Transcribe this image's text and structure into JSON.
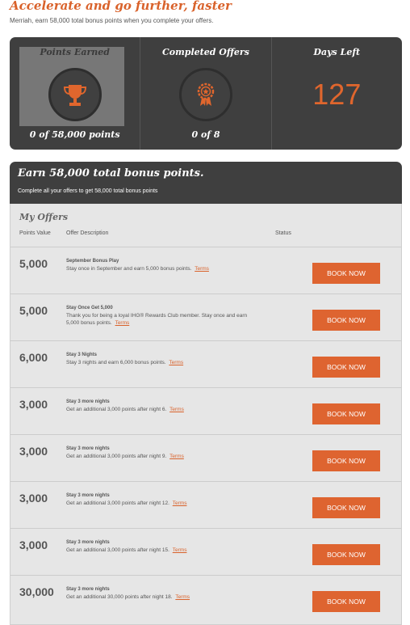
{
  "header": {
    "title": "Accelerate and go further, faster",
    "subtitle": "Merriah, earn 58,000 total bonus points when you complete your offers."
  },
  "stats": {
    "points": {
      "title": "Points Earned",
      "icon": "trophy-icon",
      "caption": "0 of 58,000 points"
    },
    "offers": {
      "title": "Completed Offers",
      "icon": "award-ribbon-icon",
      "caption": "0 of 8"
    },
    "days": {
      "title": "Days Left",
      "value": "127"
    }
  },
  "colors": {
    "accent": "#de6430",
    "dark_panel": "#3f3f3f",
    "list_bg": "#e6e6e6"
  },
  "earn": {
    "title": "Earn 58,000 total bonus points.",
    "subtitle": "Complete all your offers to get 58,000 total bonus points"
  },
  "offers": {
    "title": "My Offers",
    "columns": {
      "points": "Points Value",
      "description": "Offer Description",
      "status": "Status"
    },
    "button_label": "BOOK NOW",
    "terms_label": "Terms",
    "rows": [
      {
        "points": "5,000",
        "name": "September Bonus Play",
        "desc": "Stay once in September and earn 5,000 bonus points."
      },
      {
        "points": "5,000",
        "name": "Stay Once Get 5,000",
        "desc": "Thank you for being a loyal IHG® Rewards Club member. Stay once and earn 5,000 bonus points."
      },
      {
        "points": "6,000",
        "name": "Stay 3 Nights",
        "desc": "Stay 3 nights and earn 6,000 bonus points."
      },
      {
        "points": "3,000",
        "name": "Stay 3 more nights",
        "desc": "Get an additional 3,000 points after night 6."
      },
      {
        "points": "3,000",
        "name": "Stay 3 more nights",
        "desc": "Get an additional 3,000 points after night 9."
      },
      {
        "points": "3,000",
        "name": "Stay 3 more nights",
        "desc": "Get an additional 3,000 points after night 12."
      },
      {
        "points": "3,000",
        "name": "Stay 3 more nights",
        "desc": "Get an additional 3,000 points after night 15."
      },
      {
        "points": "30,000",
        "name": "Stay 3 more nights",
        "desc": "Get an additional 30,000 points after night 18."
      }
    ]
  }
}
